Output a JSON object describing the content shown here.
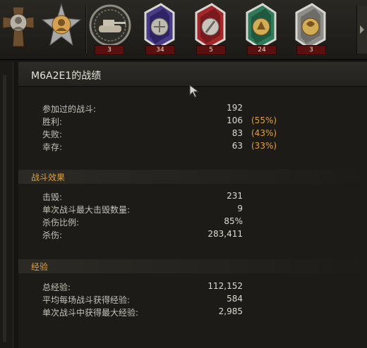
{
  "medals": [
    {
      "name": "bronze-cross-medal",
      "count": ""
    },
    {
      "name": "star-portrait-medal",
      "count": ""
    },
    {
      "name": "tank-wreath-medal",
      "count": "3"
    },
    {
      "name": "purple-ribbon-medal",
      "count": "34"
    },
    {
      "name": "red-ribbon-medal",
      "count": "5"
    },
    {
      "name": "green-ribbon-medal",
      "count": "24"
    },
    {
      "name": "gray-ribbon-medal",
      "count": "3"
    }
  ],
  "panel": {
    "title": "M6A2E1的战绩",
    "battles": {
      "rows": [
        {
          "label": "参加过的战斗:",
          "value": "192",
          "pct": ""
        },
        {
          "label": "胜利:",
          "value": "106",
          "pct": "(55%)"
        },
        {
          "label": "失败:",
          "value": "83",
          "pct": "(43%)"
        },
        {
          "label": "幸存:",
          "value": "63",
          "pct": "(33%)"
        }
      ]
    },
    "effect": {
      "title": "战斗效果",
      "rows": [
        {
          "label": "击毁:",
          "value": "231"
        },
        {
          "label": "单次战斗最大击毁数量:",
          "value": "9"
        },
        {
          "label": "杀伤比例:",
          "value": "85%"
        },
        {
          "label": "杀伤:",
          "value": "283,411"
        }
      ]
    },
    "experience": {
      "title": "经验",
      "rows": [
        {
          "label": "总经验:",
          "value": "112,152"
        },
        {
          "label": "平均每场战斗获得经验:",
          "value": "584"
        },
        {
          "label": "单次战斗中获得最大经验:",
          "value": "2,985"
        }
      ]
    }
  },
  "colors": {
    "accent": "#e0a13a",
    "count_badge": "#5b1010",
    "panel_bg": "#1c1b18"
  }
}
